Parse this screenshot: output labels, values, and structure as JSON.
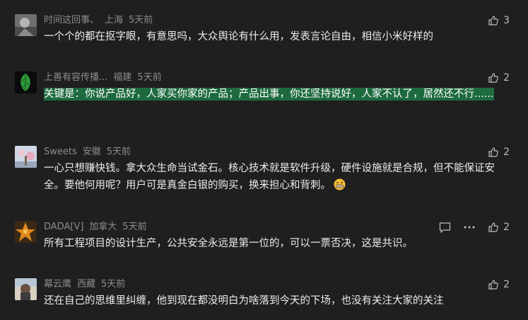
{
  "comments": [
    {
      "author": "时间这回事、",
      "location": "上海",
      "time": "5天前",
      "text": "一个个的都在抠字眼，有意思吗，大众舆论有什么用，发表言论自由，相信小米好样的",
      "likes": "3"
    },
    {
      "author": "上善有容传播...",
      "location": "福建",
      "time": "5天前",
      "text": "关键是：你说产品好，人家买你家的产品；产品出事，你还坚持说好，人家不认了，居然还不行......",
      "likes": "2",
      "highlighted": true
    },
    {
      "author": "Sweets",
      "location": "安徽",
      "time": "5天前",
      "text": "一心只想赚快钱。拿大众生命当试金石。核心技术就是软件升级，硬件设施就是合规，但不能保证安全。要他何用呢？用户可是真金白银的购买，换来担心和背刺。",
      "emoji": "grimacing-emoji",
      "likes": "2"
    },
    {
      "author": "DADA[V]",
      "location": "加拿大",
      "time": "5天前",
      "text": "所有工程项目的设计生产，公共安全永远是第一位的，可以一票否决，这是共识。",
      "likes": "2",
      "show_reply": true
    },
    {
      "author": "幕云鹰",
      "location": "西藏",
      "time": "5天前",
      "text": "还在自己的思维里纠缠，他到现在都没明白为啥落到今天的下场，也没有关注大家的关注",
      "likes": "2"
    }
  ],
  "icons": {
    "like": "thumbs-up-icon",
    "reply": "comment-icon",
    "more": "more-icon"
  },
  "colors": {
    "background": "#1f1f1f",
    "highlight": "#1e6a3f",
    "meta_text": "#8c8c8c"
  }
}
